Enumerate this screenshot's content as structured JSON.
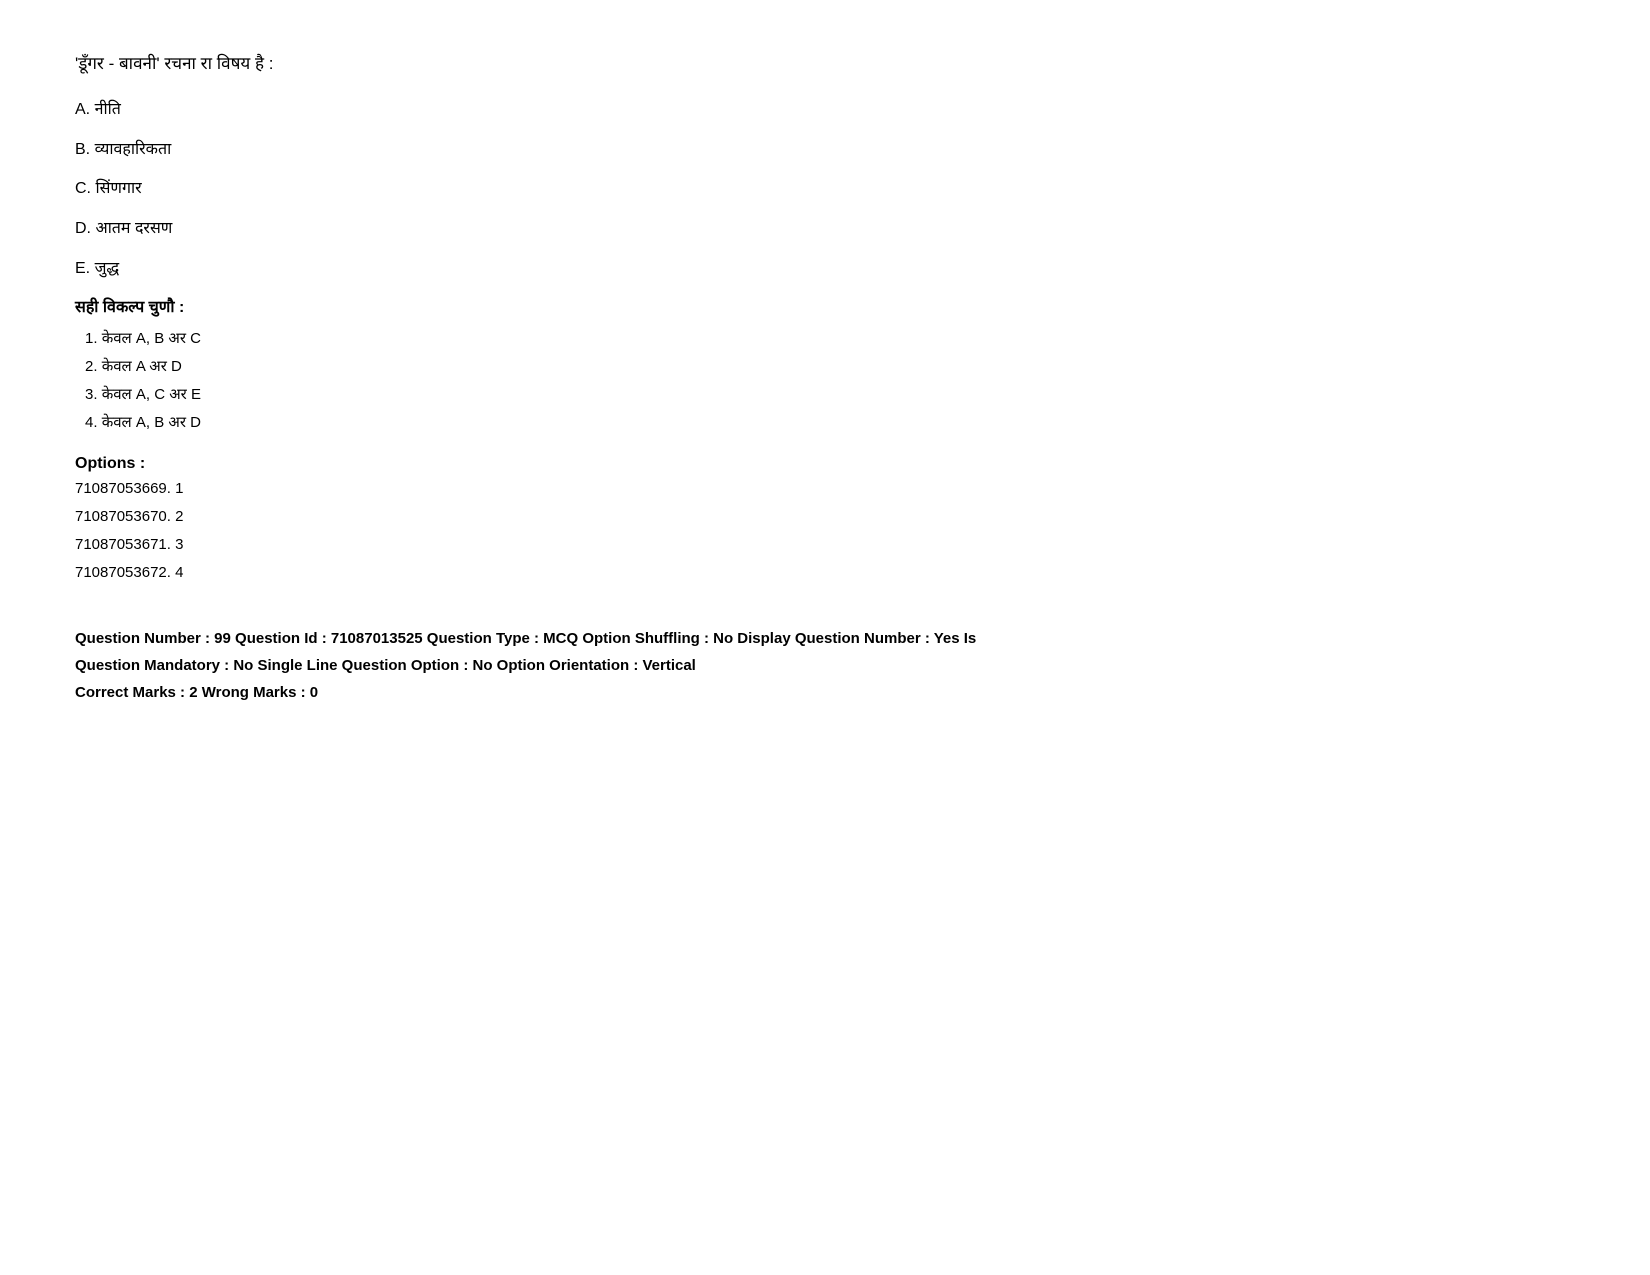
{
  "question": {
    "text": "'डूँगर - बावनी' रचना रा विषय है :",
    "options": [
      {
        "label": "A.",
        "text": "नीति"
      },
      {
        "label": "B.",
        "text": "व्यावहारिकता"
      },
      {
        "label": "C.",
        "text": "सिंणगार"
      },
      {
        "label": "D.",
        "text": "आतम दरसण"
      },
      {
        "label": "E.",
        "text": " जुद्ध"
      }
    ],
    "select_prompt": "सही विकल्प चुणौ :",
    "choices": [
      {
        "num": "1.",
        "text": "केवल A, B अर C"
      },
      {
        "num": "2.",
        "text": "केवल A अर D"
      },
      {
        "num": "3.",
        "text": "केवल A, C अर E"
      },
      {
        "num": "4.",
        "text": "केवल A, B अर D"
      }
    ]
  },
  "options_section": {
    "label": "Options :",
    "items": [
      {
        "code": "71087053669.",
        "value": "1"
      },
      {
        "code": "71087053670.",
        "value": "2"
      },
      {
        "code": "71087053671.",
        "value": "3"
      },
      {
        "code": "71087053672.",
        "value": "4"
      }
    ]
  },
  "metadata": {
    "line1": "Question Number : 99 Question Id : 71087013525 Question Type : MCQ Option Shuffling : No Display Question Number : Yes Is",
    "line2": "Question Mandatory : No Single Line Question Option : No Option Orientation : Vertical",
    "line3": "Correct Marks : 2 Wrong Marks : 0"
  }
}
